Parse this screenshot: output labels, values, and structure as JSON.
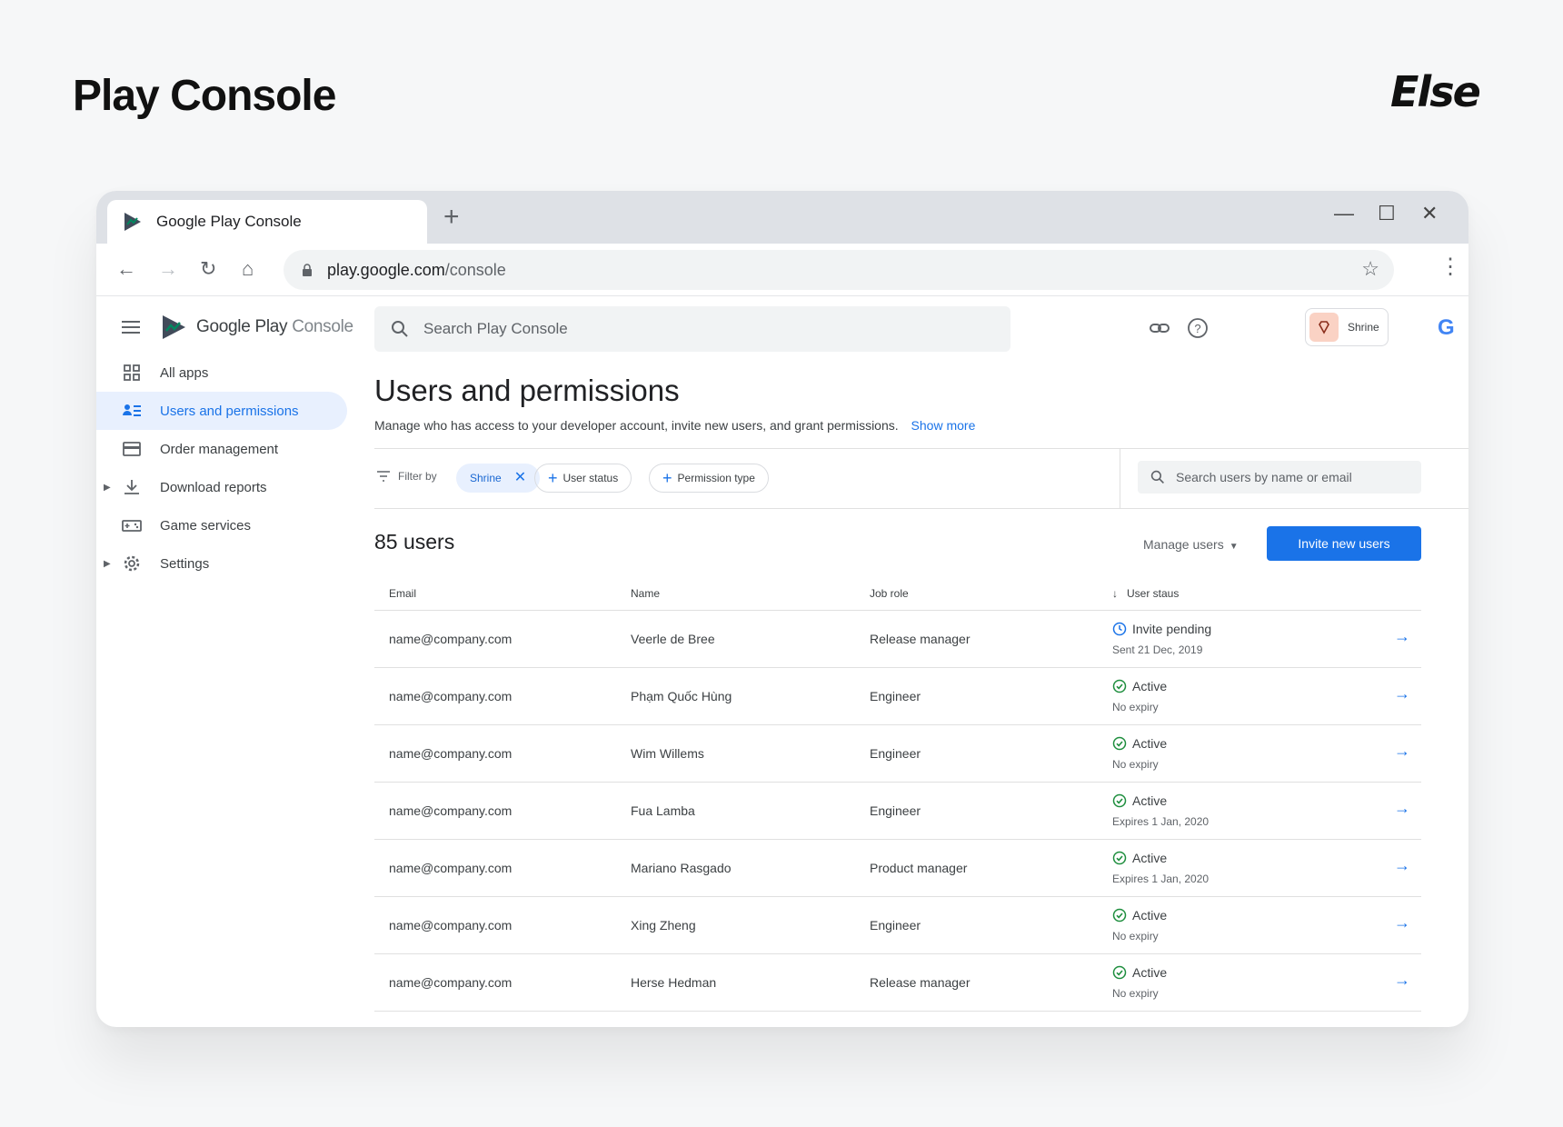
{
  "header": {
    "title": "Play Console",
    "brand": "Else"
  },
  "browser": {
    "tab_title": "Google Play Console",
    "new_tab": "+",
    "url_host": "play.google.com",
    "url_path": " /console"
  },
  "sidebar": {
    "logo_text": "Google Play",
    "logo_suffix": " Console",
    "items": [
      {
        "label": "All apps"
      },
      {
        "label": "Users and permissions"
      },
      {
        "label": "Order management"
      },
      {
        "label": "Download reports"
      },
      {
        "label": "Game services"
      },
      {
        "label": "Settings"
      }
    ]
  },
  "main": {
    "search_placeholder": "Search Play Console",
    "account_label": "Shrine",
    "heading": "Users and permissions",
    "description": "Manage who has access to your developer account, invite new users, and grant permissions.",
    "show_more": "Show more",
    "filter_label": "Filter by",
    "filters": [
      "Shrine",
      "User status",
      "Permission type"
    ],
    "user_search_placeholder": "Search users by name or email",
    "user_count": "85 users",
    "manage_users": "Manage users",
    "invite_button": "Invite new users",
    "columns": [
      "Email",
      "Name",
      "Job role",
      "User staus"
    ],
    "rows": [
      {
        "email": "name@company.com",
        "name": "Veerle de Bree",
        "role": "Release manager",
        "status": "Invite pending",
        "sub": "Sent 21 Dec, 2019",
        "pending": true
      },
      {
        "email": "name@company.com",
        "name": "Phạm Quốc Hùng",
        "role": "Engineer",
        "status": "Active",
        "sub": "No expiry"
      },
      {
        "email": "name@company.com",
        "name": "Wim Willems",
        "role": "Engineer",
        "status": "Active",
        "sub": "No expiry"
      },
      {
        "email": "name@company.com",
        "name": "Fua Lamba",
        "role": "Engineer",
        "status": "Active",
        "sub": "Expires 1 Jan, 2020"
      },
      {
        "email": "name@company.com",
        "name": "Mariano Rasgado",
        "role": "Product manager",
        "status": "Active",
        "sub": "Expires 1 Jan, 2020"
      },
      {
        "email": "name@company.com",
        "name": "Xing Zheng",
        "role": "Engineer",
        "status": "Active",
        "sub": "No expiry"
      },
      {
        "email": "name@company.com",
        "name": "Herse Hedman",
        "role": "Release manager",
        "status": "Active",
        "sub": "No expiry"
      }
    ]
  },
  "colors": {
    "accent": "#1a73e8",
    "active_green": "#1e8e3e",
    "selected_bg": "#e8f0fe"
  }
}
